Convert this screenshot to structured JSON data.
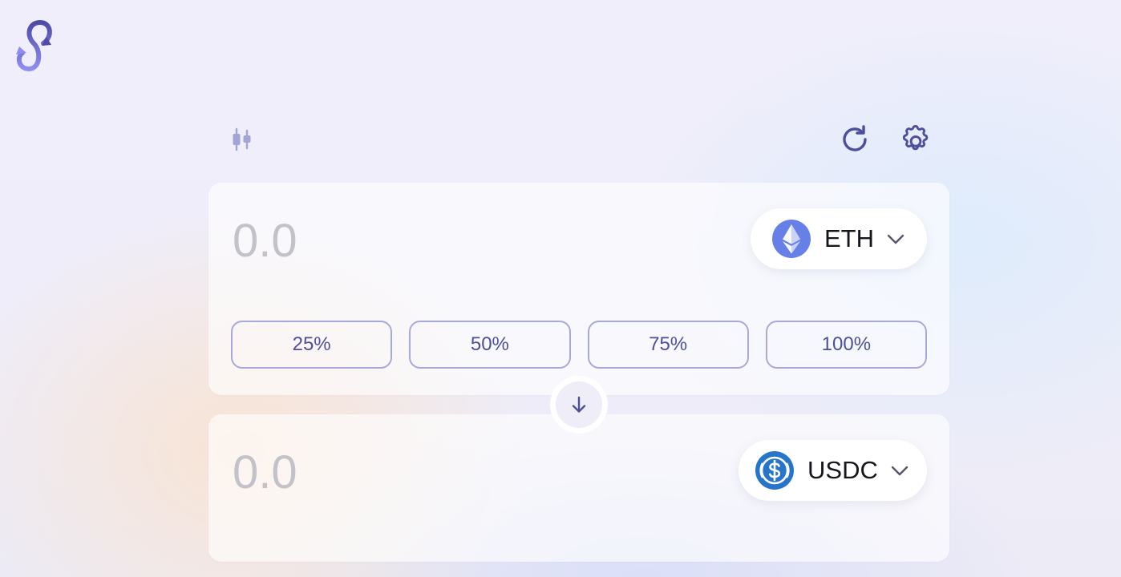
{
  "app": {
    "logo_icon": "loop-logo-icon"
  },
  "toolbar": {
    "chart_icon": "candlestick-chart-icon",
    "refresh_icon": "refresh-icon",
    "settings_icon": "gear-icon"
  },
  "sell": {
    "amount_placeholder": "0.0",
    "token_symbol": "ETH",
    "token_icon": "ethereum-icon",
    "percent_buttons": [
      "25%",
      "50%",
      "75%",
      "100%"
    ]
  },
  "switch": {
    "icon": "arrow-down-icon"
  },
  "buy": {
    "amount_placeholder": "0.0",
    "token_symbol": "USDC",
    "token_icon": "usdc-icon"
  },
  "colors": {
    "accent": "#4d4f9a",
    "button_border": "#a8a9d8",
    "eth_blue": "#6680e8",
    "usdc_blue": "#2775ca",
    "placeholder_grey": "#c2c2c8"
  }
}
